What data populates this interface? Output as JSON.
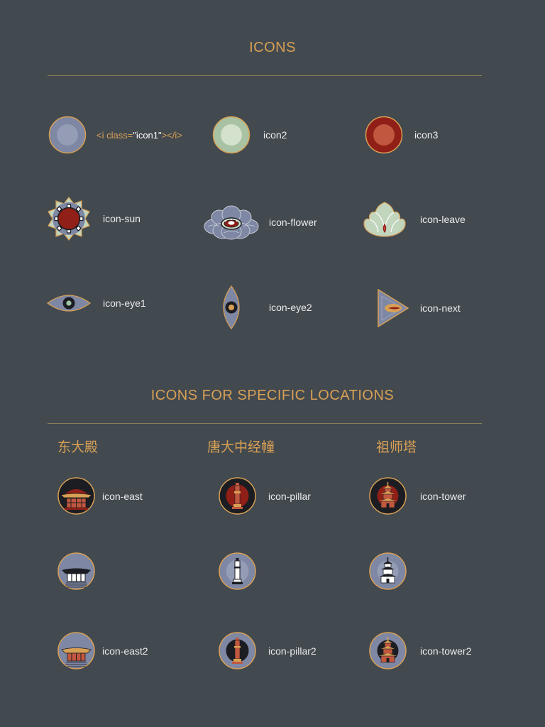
{
  "section1": {
    "title": "ICONS",
    "items": [
      {
        "name": "icon1",
        "code": {
          "open": "<i class=",
          "cls": "\"icon1\"",
          "close": "></i>"
        }
      },
      {
        "name": "icon2",
        "label": "icon2"
      },
      {
        "name": "icon3",
        "label": "icon3"
      },
      {
        "name": "icon-sun",
        "label": "icon-sun"
      },
      {
        "name": "icon-flower",
        "label": "icon-flower"
      },
      {
        "name": "icon-leave",
        "label": "icon-leave"
      },
      {
        "name": "icon-eye1",
        "label": "icon-eye1"
      },
      {
        "name": "icon-eye2",
        "label": "icon-eye2"
      },
      {
        "name": "icon-next",
        "label": "icon-next"
      }
    ]
  },
  "section2": {
    "title": "ICONS FOR SPECIFIC LOCATIONS",
    "columns": [
      "东大殿",
      "唐大中经幢",
      "祖师塔"
    ],
    "items": [
      {
        "name": "icon-east",
        "label": "icon-east"
      },
      {
        "name": "icon-pillar",
        "label": "icon-pillar"
      },
      {
        "name": "icon-tower",
        "label": "icon-tower"
      },
      {
        "name": "icon-east-gray"
      },
      {
        "name": "icon-pillar-gray"
      },
      {
        "name": "icon-tower-gray"
      },
      {
        "name": "icon-east2",
        "label": "icon-east2"
      },
      {
        "name": "icon-pillar2",
        "label": "icon-pillar2"
      },
      {
        "name": "icon-tower2",
        "label": "icon-tower2"
      }
    ]
  },
  "colors": {
    "background": "#42494f",
    "accent": "#d8a055",
    "blue_gray": "#7e87a3",
    "sage": "#c2d5bd",
    "red": "#8f1f17",
    "dark": "#1c1d22"
  }
}
